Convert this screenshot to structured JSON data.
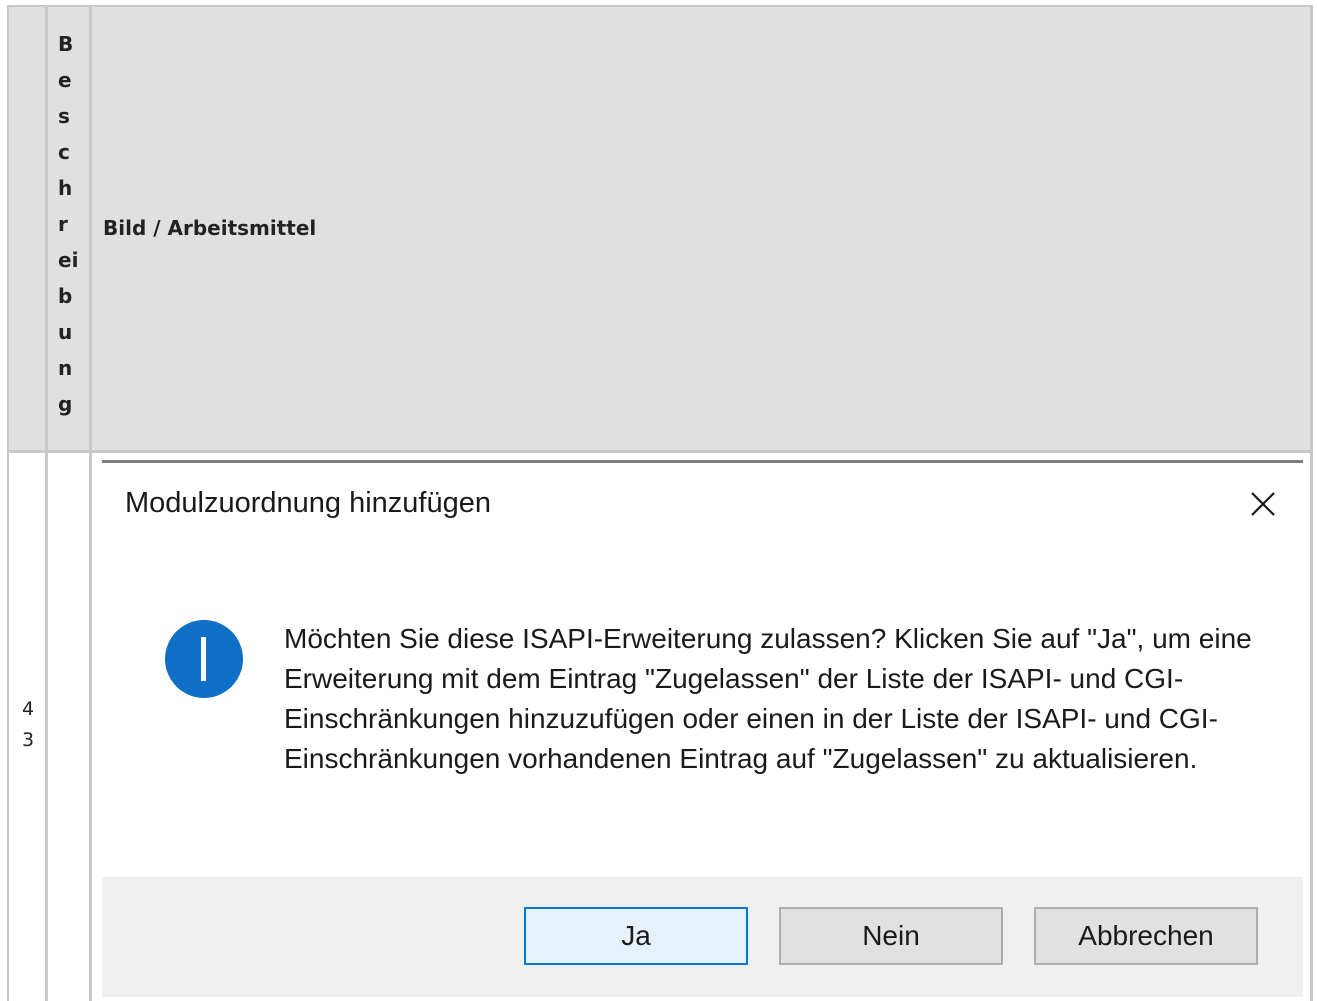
{
  "table": {
    "header_vertical_chars": [
      "B",
      "e",
      "s",
      "c",
      "h",
      "r",
      "ei",
      "b",
      "u",
      "n",
      "g"
    ],
    "header_image_col": "Bild / Arbeitsmittel",
    "row_number_chars": [
      "4",
      "3"
    ]
  },
  "dialog": {
    "title": "Modulzuordnung hinzufügen",
    "message": "Möchten Sie diese ISAPI-Erweiterung zulassen? Klicken Sie auf \"Ja\", um eine Erweiterung mit dem Eintrag \"Zugelassen\" der Liste der ISAPI- und CGI-Einschränkungen hinzuzufügen oder einen in der Liste der ISAPI- und CGI-Einschränkungen vorhandenen Eintrag auf \"Zugelassen\" zu aktualisieren.",
    "icon": "info-icon",
    "close_icon": "close-icon",
    "buttons": {
      "yes": "Ja",
      "no": "Nein",
      "cancel": "Abbrechen"
    },
    "accent_color": "#0078d7",
    "info_color": "#0f6fc6"
  }
}
